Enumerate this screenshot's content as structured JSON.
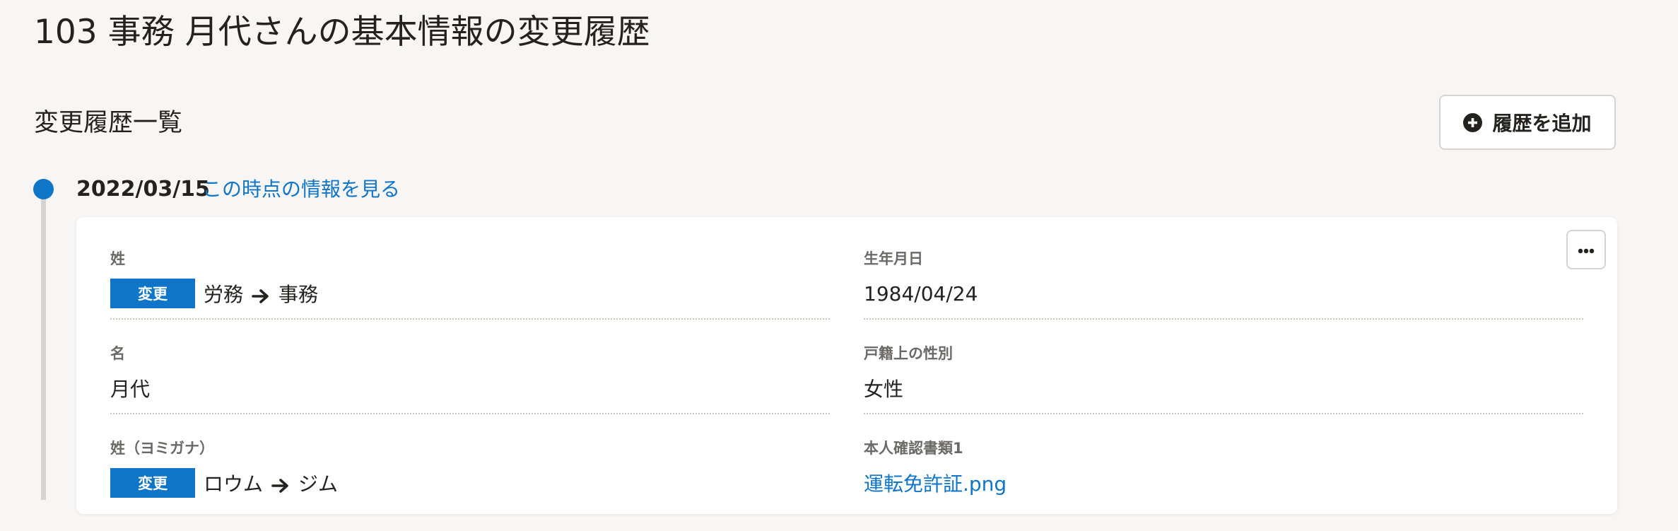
{
  "page": {
    "title": "103 事務 月代さんの基本情報の変更履歴"
  },
  "history": {
    "section_title": "変更履歴一覧",
    "add_button_label": "履歴を追加"
  },
  "entry": {
    "date": "2022/03/15",
    "view_link": "この時点の情報を見る",
    "fields": {
      "last_name": {
        "label": "姓",
        "badge": "変更",
        "old_value": "労務",
        "new_value": "事務"
      },
      "first_name": {
        "label": "名",
        "value": "月代"
      },
      "last_name_kana": {
        "label": "姓（ヨミガナ）",
        "badge": "変更",
        "old_value": "ロウム",
        "new_value": "ジム"
      },
      "birth_date": {
        "label": "生年月日",
        "value": "1984/04/24"
      },
      "registered_gender": {
        "label": "戸籍上の性別",
        "value": "女性"
      },
      "id_document_1": {
        "label": "本人確認書類1",
        "value": "運転免許証.png"
      }
    }
  },
  "icons": {
    "add": "plus-circle-icon",
    "arrow": "arrow-right-icon",
    "more": "ellipsis-icon"
  },
  "colors": {
    "accent": "#0f75c8",
    "background": "#f7f6f4",
    "card": "#ffffff",
    "text": "#23221f",
    "muted_label": "#6b6966",
    "border": "#d6d3d0"
  }
}
